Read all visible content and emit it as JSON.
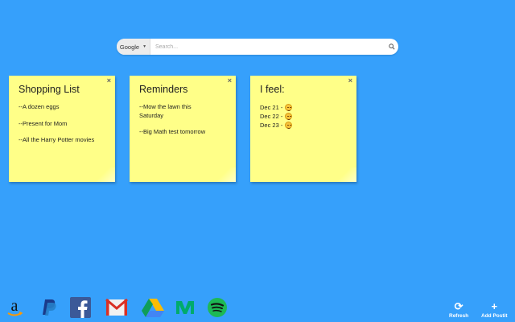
{
  "search": {
    "engine": "Google",
    "placeholder": "Search..."
  },
  "notes": [
    {
      "title": "Shopping List",
      "close": "×",
      "lines": [
        "--A dozen eggs",
        "--Present for Mom",
        "--All the Harry Potter movies"
      ]
    },
    {
      "title": "Reminders",
      "close": "×",
      "lines": [
        "--Mow the lawn this Saturday",
        "--Big Math test tomorrow"
      ]
    },
    {
      "title": "I feel:",
      "close": "×",
      "moods": [
        "Dec 21 -",
        "Dec 22 -",
        "Dec 23 -"
      ]
    }
  ],
  "dock": {
    "apps": [
      "amazon-icon",
      "paypal-icon",
      "facebook-icon",
      "gmail-icon",
      "google-drive-icon",
      "medium-icon",
      "spotify-icon"
    ],
    "refresh_label": "Refresh",
    "add_label": "Add Postit"
  },
  "colors": {
    "background": "#36a0fb",
    "note": "#ffff88"
  }
}
